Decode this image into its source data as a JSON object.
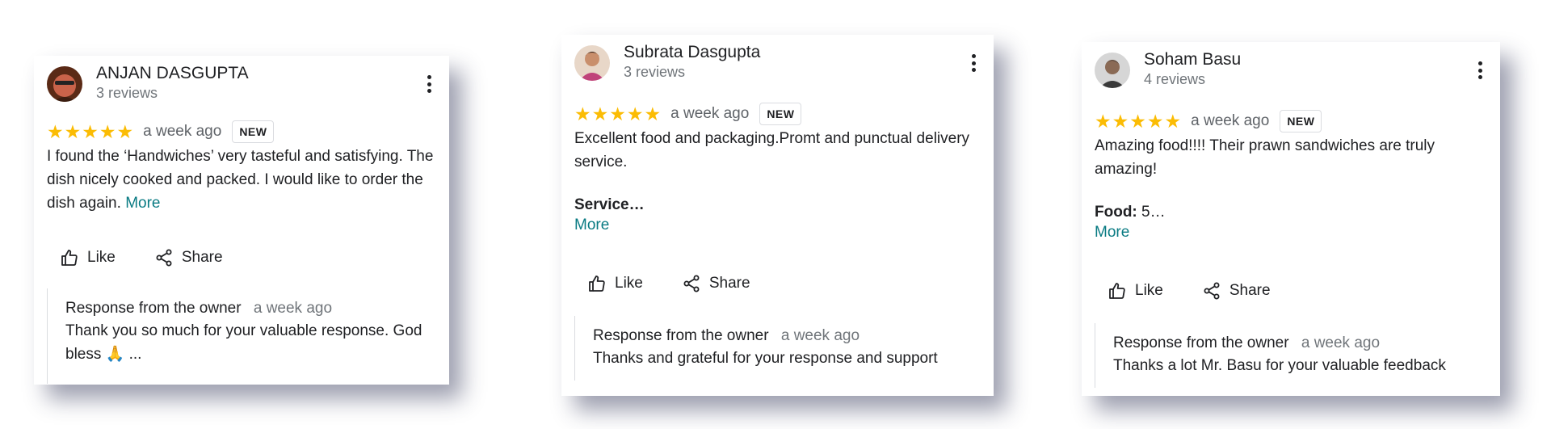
{
  "accent": "#0a7b83",
  "star_color": "#fbbc04",
  "reviews": [
    {
      "reviewer_name": "ANJAN DASGUPTA",
      "reviewer_count": "3 reviews",
      "rating": 5,
      "time": "a week ago",
      "badge": "NEW",
      "text": "I found the ‘Handwiches’ very tasteful and satisfying. The dish nicely cooked and packed. I would like to order the dish again.",
      "more": "More",
      "like_label": "Like",
      "share_label": "Share",
      "response_label": "Response from the owner",
      "response_time": "a week ago",
      "response_text": "Thank you so much for your valuable response. God bless 🙏 ..."
    },
    {
      "reviewer_name": "Subrata Dasgupta",
      "reviewer_count": "3 reviews",
      "rating": 5,
      "time": "a week ago",
      "badge": "NEW",
      "text": "Excellent food and packaging.Promt and punctual delivery service.",
      "extra_bold": "Service…",
      "more": "More",
      "like_label": "Like",
      "share_label": "Share",
      "response_label": "Response from the owner",
      "response_time": "a week ago",
      "response_text": "Thanks and grateful for your response and support"
    },
    {
      "reviewer_name": "Soham Basu",
      "reviewer_count": "4 reviews",
      "rating": 5,
      "time": "a week ago",
      "badge": "NEW",
      "text": "Amazing food!!!! Their prawn sandwiches are truly amazing!",
      "extra_bold": "Food:",
      "extra_rest": " 5…",
      "more": "More",
      "like_label": "Like",
      "share_label": "Share",
      "response_label": "Response from the owner",
      "response_time": "a week ago",
      "response_text": "Thanks a lot Mr. Basu for your valuable feedback"
    }
  ]
}
